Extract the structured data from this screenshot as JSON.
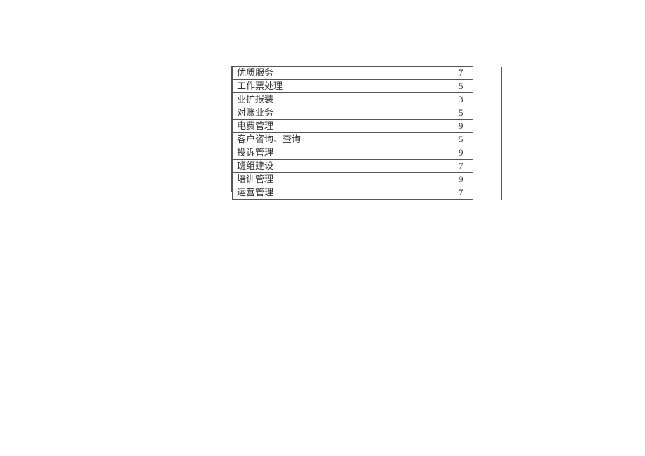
{
  "table": {
    "rows": [
      {
        "label": "优质服务",
        "value": "7"
      },
      {
        "label": "工作票处理",
        "value": "5"
      },
      {
        "label": "业扩报装",
        "value": "3"
      },
      {
        "label": "对账业务",
        "value": "5"
      },
      {
        "label": "电费管理",
        "value": "9"
      },
      {
        "label": "客户咨询、查询",
        "value": "5"
      },
      {
        "label": "投诉管理",
        "value": "9"
      },
      {
        "label": "班组建设",
        "value": "7"
      },
      {
        "label": "培训管理",
        "value": "9"
      },
      {
        "label": "运营管理",
        "value": "7"
      }
    ]
  }
}
